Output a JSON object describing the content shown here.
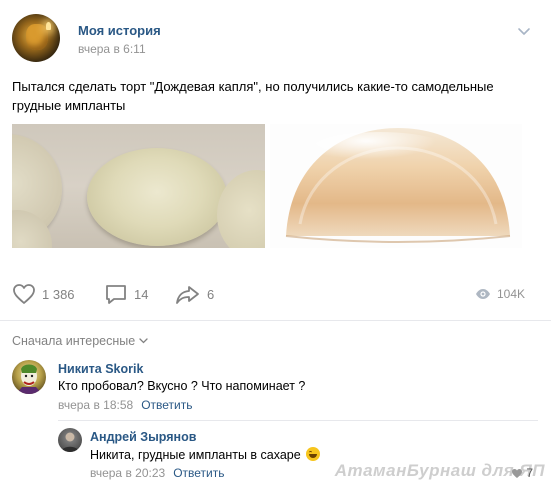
{
  "post": {
    "author": "Моя история",
    "date": "вчера в 6:11",
    "text": "Пытался сделать торт \"Дождевая капля\", но получились какие-то самодельные грудные импланты",
    "likes": "1 386",
    "comments": "14",
    "shares": "6",
    "views": "104K"
  },
  "comments_section": {
    "sort_label": "Сначала интересные",
    "items": [
      {
        "author": "Никита Skorik",
        "text": "Кто пробовал? Вкусно ? Что напоминает ?",
        "time": "вчера в 18:58",
        "reply": "Ответить"
      },
      {
        "author": "Андрей Зырянов",
        "text": "Никита, грудные импланты в сахаре",
        "time": "вчера в 20:23",
        "reply": "Ответить",
        "likes": "7"
      }
    ]
  },
  "watermark": "АтаманБурнаш для ЯП",
  "icons": {
    "like": "heart-icon",
    "comment": "comment-icon",
    "share": "share-icon",
    "views": "eye-icon",
    "menu": "chevron-down-icon",
    "emoji": "laughing-emoji-icon"
  },
  "colors": {
    "link": "#2a5885",
    "meta": "#939393",
    "icon": "#828282",
    "separator": "#e7e8ec"
  }
}
